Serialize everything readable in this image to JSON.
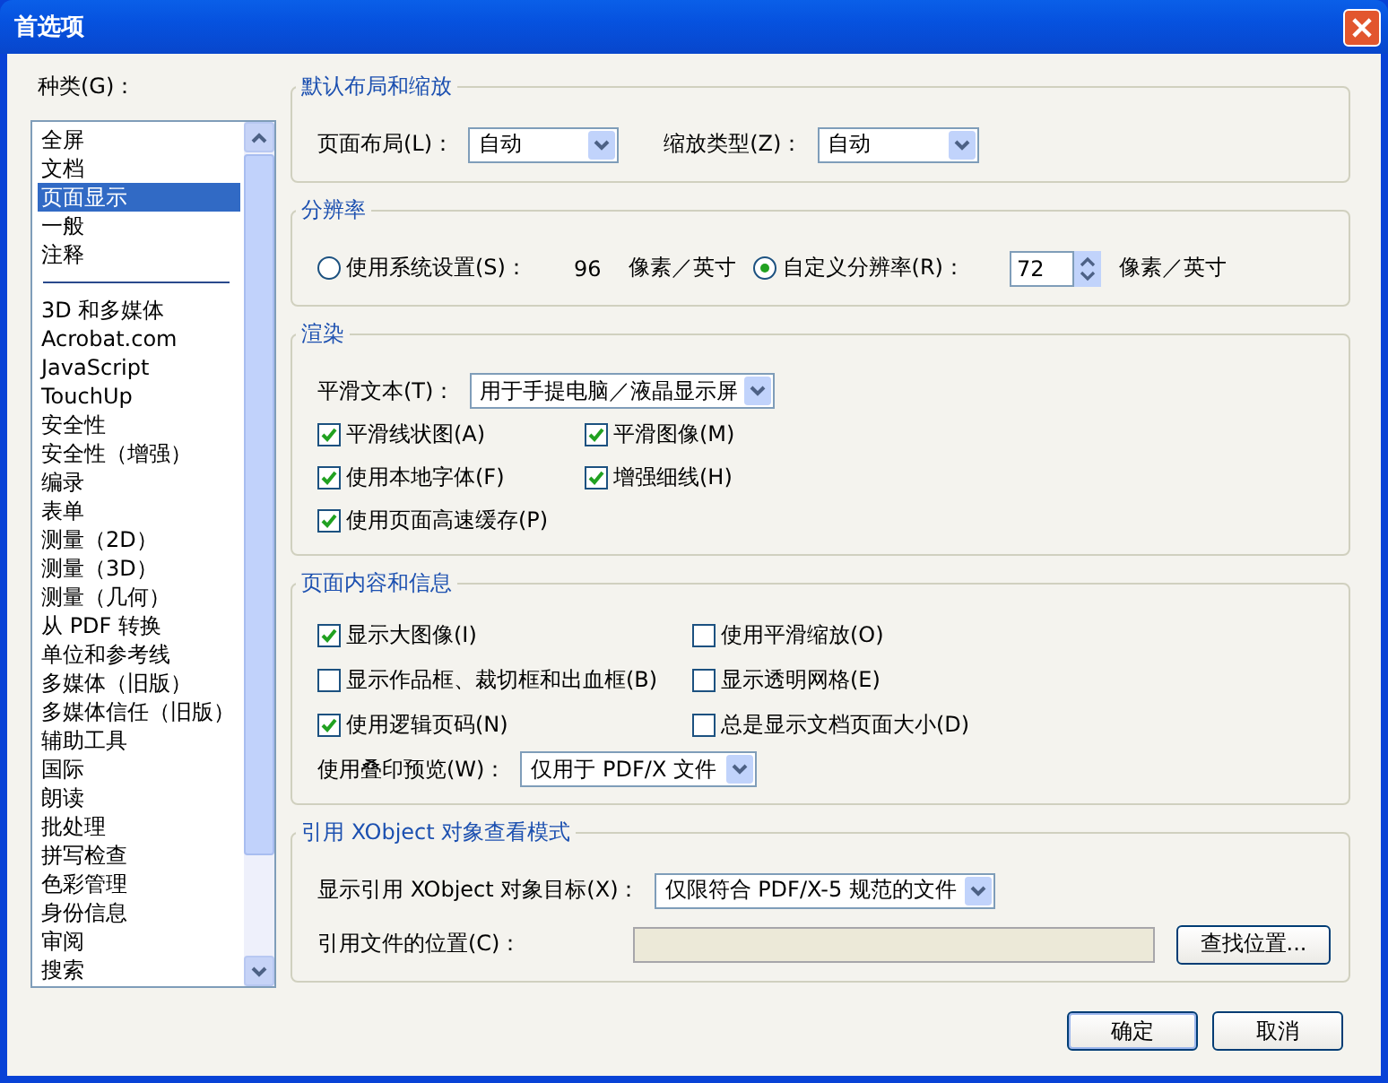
{
  "window": {
    "title": "首选项"
  },
  "categories": {
    "label": "种类(G)：",
    "groups": [
      [
        {
          "label": "全屏",
          "selected": false
        },
        {
          "label": "文档",
          "selected": false
        },
        {
          "label": "页面显示",
          "selected": true
        },
        {
          "label": "一般",
          "selected": false
        },
        {
          "label": "注释",
          "selected": false
        }
      ],
      [
        {
          "label": "3D 和多媒体",
          "selected": false
        },
        {
          "label": "Acrobat.com",
          "selected": false
        },
        {
          "label": "JavaScript",
          "selected": false
        },
        {
          "label": "TouchUp",
          "selected": false
        },
        {
          "label": "安全性",
          "selected": false
        },
        {
          "label": "安全性（增强）",
          "selected": false
        },
        {
          "label": "编录",
          "selected": false
        },
        {
          "label": "表单",
          "selected": false
        },
        {
          "label": "测量（2D）",
          "selected": false
        },
        {
          "label": "测量（3D）",
          "selected": false
        },
        {
          "label": "测量（几何）",
          "selected": false
        },
        {
          "label": "从 PDF 转换",
          "selected": false
        },
        {
          "label": "单位和参考线",
          "selected": false
        },
        {
          "label": "多媒体（旧版）",
          "selected": false
        },
        {
          "label": "多媒体信任（旧版）",
          "selected": false
        },
        {
          "label": "辅助工具",
          "selected": false
        },
        {
          "label": "国际",
          "selected": false
        },
        {
          "label": "朗读",
          "selected": false
        },
        {
          "label": "批处理",
          "selected": false
        },
        {
          "label": "拼写检查",
          "selected": false
        },
        {
          "label": "色彩管理",
          "selected": false
        },
        {
          "label": "身份信息",
          "selected": false
        },
        {
          "label": "审阅",
          "selected": false
        },
        {
          "label": "搜索",
          "selected": false
        }
      ]
    ]
  },
  "sections": [
    {
      "title": "默认布局和缩放",
      "rows": [
        [
          {
            "kind": "select",
            "label": "页面布局(L)：",
            "value": "自动"
          },
          {
            "kind": "select",
            "label": "缩放类型(Z)：",
            "value": "自动"
          }
        ]
      ]
    },
    {
      "title": "分辨率",
      "rows": [
        [
          {
            "kind": "radio",
            "label": "使用系统设置(S)：",
            "selected": false
          },
          {
            "kind": "text",
            "text": "96"
          },
          {
            "kind": "text",
            "text": "像素／英寸"
          },
          {
            "kind": "radio",
            "label": "自定义分辨率(R)：",
            "selected": true
          },
          {
            "kind": "spin",
            "value": "72"
          },
          {
            "kind": "text",
            "text": "像素／英寸"
          }
        ]
      ]
    },
    {
      "title": "渲染",
      "rows": [
        [
          {
            "kind": "select",
            "label": "平滑文本(T)：",
            "value": "用于手提电脑／液晶显示屏"
          }
        ],
        [
          {
            "kind": "checkbox",
            "label": "平滑线状图(A)",
            "checked": true
          },
          {
            "kind": "checkbox",
            "label": "平滑图像(M)",
            "checked": true
          }
        ],
        [
          {
            "kind": "checkbox",
            "label": "使用本地字体(F)",
            "checked": true
          },
          {
            "kind": "checkbox",
            "label": "增强细线(H)",
            "checked": true
          }
        ],
        [
          {
            "kind": "checkbox",
            "label": "使用页面高速缓存(P)",
            "checked": true
          }
        ]
      ]
    },
    {
      "title": "页面内容和信息",
      "rows": [
        [
          {
            "kind": "checkbox",
            "label": "显示大图像(I)",
            "checked": true
          },
          {
            "kind": "checkbox",
            "label": "使用平滑缩放(O)",
            "checked": false
          }
        ],
        [
          {
            "kind": "checkbox",
            "label": "显示作品框、裁切框和出血框(B)",
            "checked": false
          },
          {
            "kind": "checkbox",
            "label": "显示透明网格(E)",
            "checked": false
          }
        ],
        [
          {
            "kind": "checkbox",
            "label": "使用逻辑页码(N)",
            "checked": true
          },
          {
            "kind": "checkbox",
            "label": "总是显示文档页面大小(D)",
            "checked": false
          }
        ],
        [
          {
            "kind": "select",
            "label": "使用叠印预览(W)：",
            "value": "仅用于 PDF/X 文件"
          }
        ]
      ]
    },
    {
      "title": "引用 XObject 对象查看模式",
      "rows": [
        [
          {
            "kind": "select",
            "label": "显示引用 XObject 对象目标(X)：",
            "value": "仅限符合 PDF/X-5 规范的文件"
          }
        ],
        [
          {
            "kind": "input",
            "label": "引用文件的位置(C)：",
            "disabled": true
          },
          {
            "kind": "button",
            "label": "查找位置..."
          }
        ]
      ]
    }
  ],
  "buttons": [
    "确定",
    "取消"
  ]
}
